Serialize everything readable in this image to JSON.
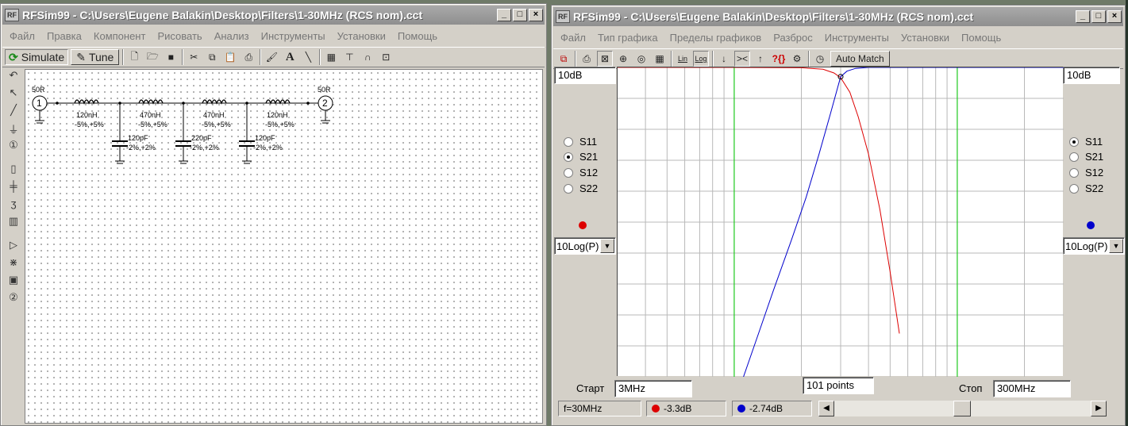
{
  "schematic_window": {
    "title": "RFSim99 - C:\\Users\\Eugene Balakin\\Desktop\\Filters\\1-30MHz (RCS nom).cct",
    "menu": [
      "Файл",
      "Правка",
      "Компонент",
      "Рисовать",
      "Анализ",
      "Инструменты",
      "Установки",
      "Помощь"
    ],
    "simulate_label": "Simulate",
    "tune_label": "Tune",
    "port1": {
      "number": "1",
      "impedance": "50R"
    },
    "port2": {
      "number": "2",
      "impedance": "50R"
    },
    "inductors": [
      {
        "value": "120nH",
        "tol": "-5%,+5%"
      },
      {
        "value": "470nH",
        "tol": "-5%,+5%"
      },
      {
        "value": "470nH",
        "tol": "-5%,+5%"
      },
      {
        "value": "120nH",
        "tol": "-5%,+5%"
      }
    ],
    "capacitors": [
      {
        "value": "120pF",
        "tol": "-2%,+2%"
      },
      {
        "value": "220pF",
        "tol": "-2%,+2%"
      },
      {
        "value": "120pF",
        "tol": "-2%,+2%"
      }
    ],
    "left_tools": [
      "rotate-icon",
      "pointer-icon",
      "wire-icon",
      "ground-icon",
      "port-icon",
      "resistor-icon",
      "capacitor-icon",
      "inductor-icon",
      "transformer-icon",
      "amplifier-icon",
      "coupled-icon",
      "block1-icon",
      "block2-icon"
    ]
  },
  "graph_window": {
    "title": "RFSim99 - C:\\Users\\Eugene Balakin\\Desktop\\Filters\\1-30MHz (RCS nom).cct",
    "menu": [
      "Файл",
      "Тип графика",
      "Пределы графиков",
      "Разброс",
      "Инструменты",
      "Установки",
      "Помощь"
    ],
    "lin_label": "Lin",
    "log_label": "Log",
    "auto_match_label": "Auto Match",
    "left_scale": "10dB",
    "right_scale": "10dB",
    "left_params": [
      "S11",
      "S21",
      "S12",
      "S22"
    ],
    "left_selected": "S21",
    "right_params": [
      "S11",
      "S21",
      "S12",
      "S22"
    ],
    "right_selected": "S11",
    "left_trace_color": "#dd0000",
    "right_trace_color": "#0000cc",
    "left_mode": "10Log(P)",
    "right_mode": "10Log(P)",
    "start_label": "Старт",
    "start_value": "3MHz",
    "points_value": "101 points",
    "stop_label": "Стоп",
    "stop_value": "300MHz",
    "status_freq": "f=30MHz",
    "status_left": "-3.3dB",
    "status_right": "-2.74dB"
  },
  "chart_data": {
    "type": "line",
    "x_scale": "log",
    "xlim": [
      3,
      300
    ],
    "ylim": [
      -100,
      0
    ],
    "grid": true,
    "markers_x": [
      10,
      100
    ],
    "cursor_x": 30,
    "series": [
      {
        "color": "#dd0000",
        "x": [
          3,
          10,
          20,
          25,
          28,
          30,
          33,
          36,
          40,
          45,
          50,
          55
        ],
        "y": [
          0,
          0,
          -0.1,
          -0.6,
          -1.8,
          -3.3,
          -8,
          -16,
          -28,
          -46,
          -66,
          -86
        ]
      },
      {
        "color": "#0000cc",
        "x": [
          11,
          13,
          15,
          18,
          21,
          24,
          27,
          30,
          32,
          35,
          40,
          50,
          300
        ],
        "y": [
          -100,
          -85,
          -72,
          -56,
          -42,
          -28,
          -15,
          -3,
          -1.2,
          -0.3,
          0,
          0,
          0
        ]
      }
    ]
  }
}
